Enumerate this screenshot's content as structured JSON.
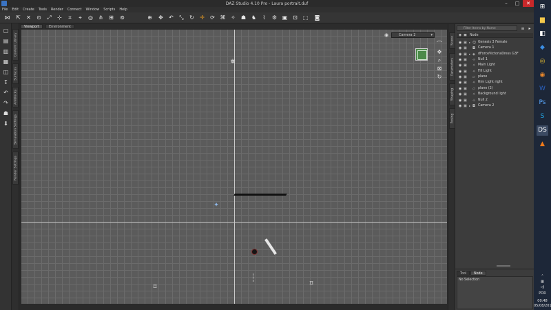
{
  "window": {
    "title": "DAZ Studio 4.10 Pro - Laura portrait.duf",
    "minimize": "–",
    "maximize": "□",
    "close": "✕"
  },
  "menu": [
    "File",
    "Edit",
    "Create",
    "Tools",
    "Render",
    "Connect",
    "Window",
    "Scripts",
    "Help"
  ],
  "left_tabs": [
    "Content Library",
    "Surfaces",
    "Aniblocks",
    "Simulation Settings",
    "Render Settings"
  ],
  "right_tabs": [
    "Scene",
    "Parameters",
    "Shaping",
    "Posing"
  ],
  "viewport": {
    "tabs": [
      "Viewport",
      "Environment"
    ],
    "camera": "Camera 2",
    "camera_caret": "▾"
  },
  "scene": {
    "search_placeholder": "Filter Items by Name",
    "header_col1": "",
    "header_node": "Node",
    "items": [
      {
        "label": "Genesis 3 Female",
        "icon": "person-icon",
        "exp": "▸",
        "depth": 0
      },
      {
        "label": "Camera 1",
        "icon": "camera-icon",
        "exp": "",
        "depth": 0
      },
      {
        "label": "dForceVictoriaDress G3F",
        "icon": "cloth-icon",
        "exp": "▸",
        "depth": 0
      },
      {
        "label": "Null 1",
        "icon": "null-icon",
        "exp": "",
        "depth": 0
      },
      {
        "label": "Main Light",
        "icon": "light-icon",
        "exp": "",
        "depth": 0
      },
      {
        "label": "Fill Light",
        "icon": "light-icon",
        "exp": "",
        "depth": 0
      },
      {
        "label": "plane",
        "icon": "plane-icon",
        "exp": "",
        "depth": 0
      },
      {
        "label": "Rim Light right",
        "icon": "light-icon",
        "exp": "",
        "depth": 0
      },
      {
        "label": "plane (2)",
        "icon": "plane-icon",
        "exp": "",
        "depth": 0
      },
      {
        "label": "Background light",
        "icon": "light-icon",
        "exp": "",
        "depth": 0
      },
      {
        "label": "Null 2",
        "icon": "null-icon",
        "exp": "",
        "depth": 0
      },
      {
        "label": "Camera 2",
        "icon": "camera-icon",
        "exp": "▸",
        "depth": 0
      }
    ]
  },
  "properties": {
    "tabs": [
      "Tool",
      "Node"
    ],
    "active_tab": "Node",
    "status": "No Selection"
  },
  "tray": {
    "lang": "POR",
    "time": "00:48",
    "date": "05/08/2018"
  },
  "colors": {
    "viewport_bg": "#5b5b5b",
    "grid": "#6b6b6b",
    "axis": "#c8c8c8",
    "nav_cube": "#4c8a4a",
    "taskbar": "#1d2738",
    "close_red": "#c8282a"
  }
}
